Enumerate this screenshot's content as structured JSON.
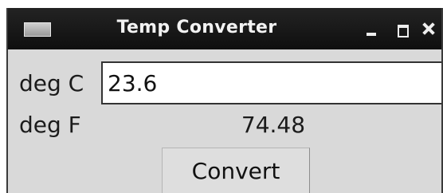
{
  "window": {
    "title": "Temp Converter"
  },
  "form": {
    "celsius_label": "deg C",
    "celsius_value": "23.6",
    "fahrenheit_label": "deg F",
    "fahrenheit_value": "74.48",
    "convert_label": "Convert"
  }
}
